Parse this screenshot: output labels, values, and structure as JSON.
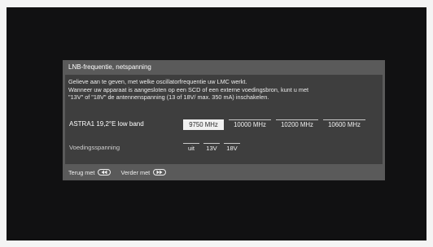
{
  "dialog": {
    "title": "LNB-frequentie, netspanning",
    "description": [
      "Gelieve aan te geven, met welke oscillatorfrequentie uw LMC werkt.",
      "Wanneer uw apparaat is aangesloten op een SCD of een externe voedingsbron, kunt u met",
      "\"13V\" of \"18V\" de antennenspanning (13 of 18V/ max. 350 mA) inschakelen."
    ],
    "satellite_row": {
      "label": "ASTRA1 19,2°E low band",
      "options": [
        "9750 MHz",
        "10000 MHz",
        "10200 MHz",
        "10600 MHz"
      ],
      "selected": "9750 MHz"
    },
    "voltage_row": {
      "label": "Voedingsspanning",
      "options": [
        "uit",
        "13V",
        "18V"
      ],
      "selected": "uit"
    },
    "footer": {
      "back_label": "Terug met",
      "back_icon": "rewind-button-icon",
      "next_label": "Verder met",
      "next_icon": "fast-forward-button-icon"
    }
  },
  "colors": {
    "background": "#111112",
    "dialog": "#5a5a5a",
    "panel": "#3e3e3e",
    "selected": "#f0f0f0"
  }
}
